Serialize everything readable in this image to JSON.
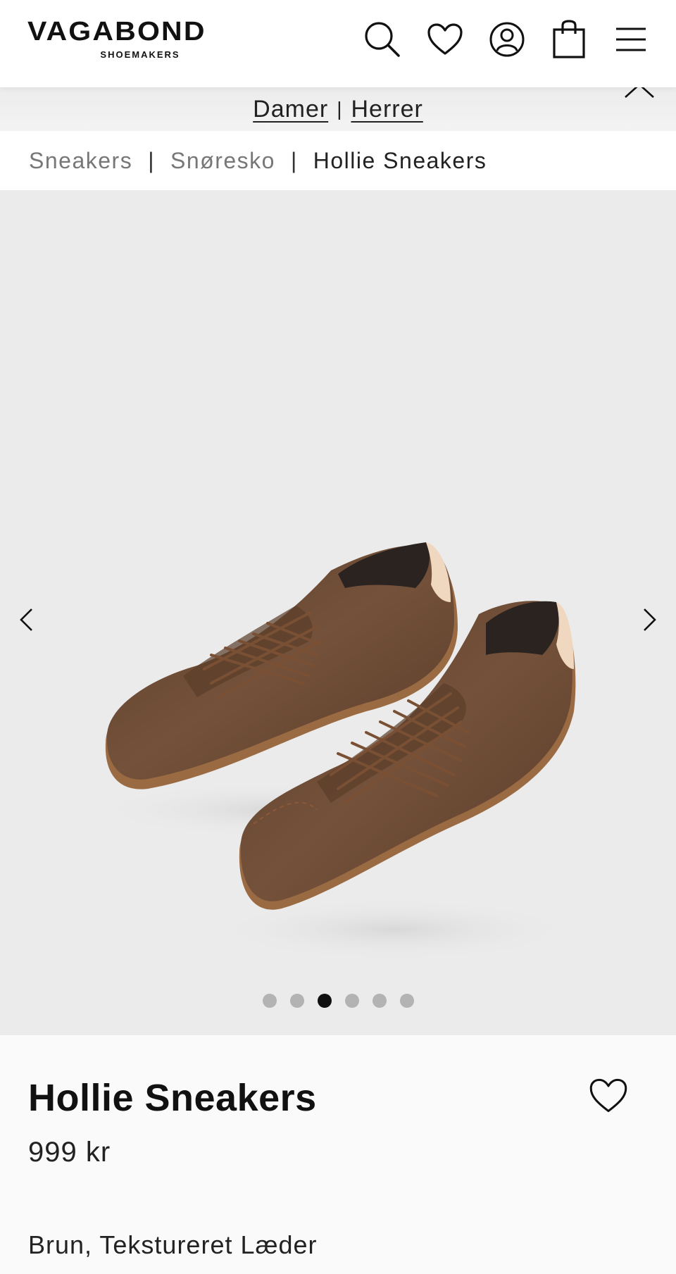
{
  "header": {
    "logo_main": "VAGABOND",
    "logo_sub": "SHOEMAKERS",
    "icons": [
      "search-icon",
      "heart-icon",
      "account-icon",
      "shopping-bag-icon",
      "menu-icon"
    ]
  },
  "gender_nav": {
    "women": "Damer",
    "separator": "|",
    "men": "Herrer"
  },
  "breadcrumb": {
    "items": [
      "Sneakers",
      "Snøresko",
      "Hollie Sneakers"
    ],
    "separator": "|"
  },
  "gallery": {
    "image_count": 6,
    "active_index": 2,
    "colors": {
      "background": "#ebebeb",
      "shoe": "#6b4a34",
      "sole": "#9a6a42",
      "heel_tab": "#efd8bf"
    }
  },
  "product": {
    "name": "Hollie Sneakers",
    "price": "999 kr",
    "color_material": "Brun, Tekstureret Læder"
  }
}
